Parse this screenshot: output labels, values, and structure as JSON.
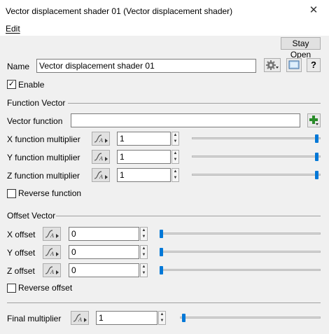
{
  "window": {
    "title": "Vector displacement shader 01    (Vector displacement shader)",
    "close_glyph": "✕"
  },
  "menu": {
    "edit": "Edit"
  },
  "toolbar": {
    "stay_open": "Stay Open"
  },
  "name": {
    "label": "Name",
    "value": "Vector displacement shader 01",
    "help": "?"
  },
  "enable": {
    "label": "Enable",
    "checked": true
  },
  "function_vector": {
    "section": "Function Vector",
    "vector_function_label": "Vector function",
    "vector_function_value": "",
    "rows": [
      {
        "label": "X function multiplier",
        "value": "1",
        "slider": 1.0
      },
      {
        "label": "Y function multiplier",
        "value": "1",
        "slider": 1.0
      },
      {
        "label": "Z function multiplier",
        "value": "1",
        "slider": 1.0
      }
    ],
    "reverse_label": "Reverse function",
    "reverse_checked": false
  },
  "offset_vector": {
    "section": "Offset Vector",
    "rows": [
      {
        "label": "X offset",
        "value": "0",
        "slider": 0.0
      },
      {
        "label": "Y offset",
        "value": "0",
        "slider": 0.0
      },
      {
        "label": "Z offset",
        "value": "0",
        "slider": 0.0
      }
    ],
    "reverse_label": "Reverse offset",
    "reverse_checked": false
  },
  "final": {
    "label": "Final multiplier",
    "value": "1",
    "slider": 0.0
  },
  "colors": {
    "accent": "#0078d7",
    "add_icon": "#2a8c2a"
  }
}
